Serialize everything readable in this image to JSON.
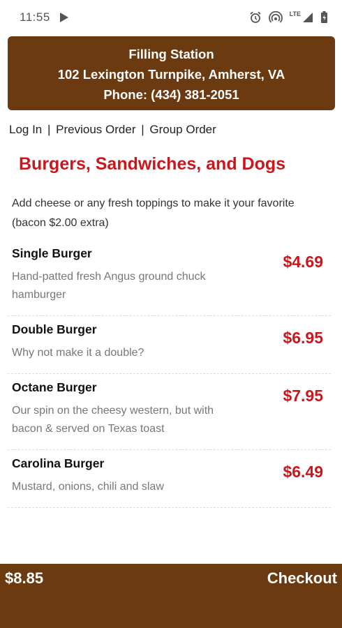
{
  "status_bar": {
    "time": "11:55",
    "network_label": "LTE",
    "icons": [
      "play-icon",
      "alarm-icon",
      "hotspot-icon",
      "signal-icon",
      "battery-icon"
    ]
  },
  "restaurant": {
    "name": "Filling Station",
    "address": "102 Lexington Turnpike, Amherst, VA",
    "phone": "Phone: (434) 381-2051"
  },
  "nav": {
    "login": "Log In",
    "separator": "|",
    "previous_order": "Previous Order",
    "group_order": "Group Order"
  },
  "section": {
    "title": "Burgers, Sandwiches, and Dogs",
    "description": "Add cheese or any fresh toppings to make it your favorite (bacon $2.00 extra)"
  },
  "items": [
    {
      "name": "Single Burger",
      "description": "Hand-patted fresh Angus ground chuck hamburger",
      "price": "$4.69"
    },
    {
      "name": "Double Burger",
      "description": "Why not make it a double?",
      "price": "$6.95"
    },
    {
      "name": "Octane Burger",
      "description": "Our spin on the cheesy western, but with bacon & served on Texas toast",
      "price": "$7.95"
    },
    {
      "name": "Carolina Burger",
      "description": "Mustard, onions, chili and slaw",
      "price": "$6.49"
    }
  ],
  "cart": {
    "total": "$8.85",
    "checkout_label": "Checkout"
  },
  "colors": {
    "brand_brown": "#6b3a10",
    "accent_red": "#c9171c"
  }
}
